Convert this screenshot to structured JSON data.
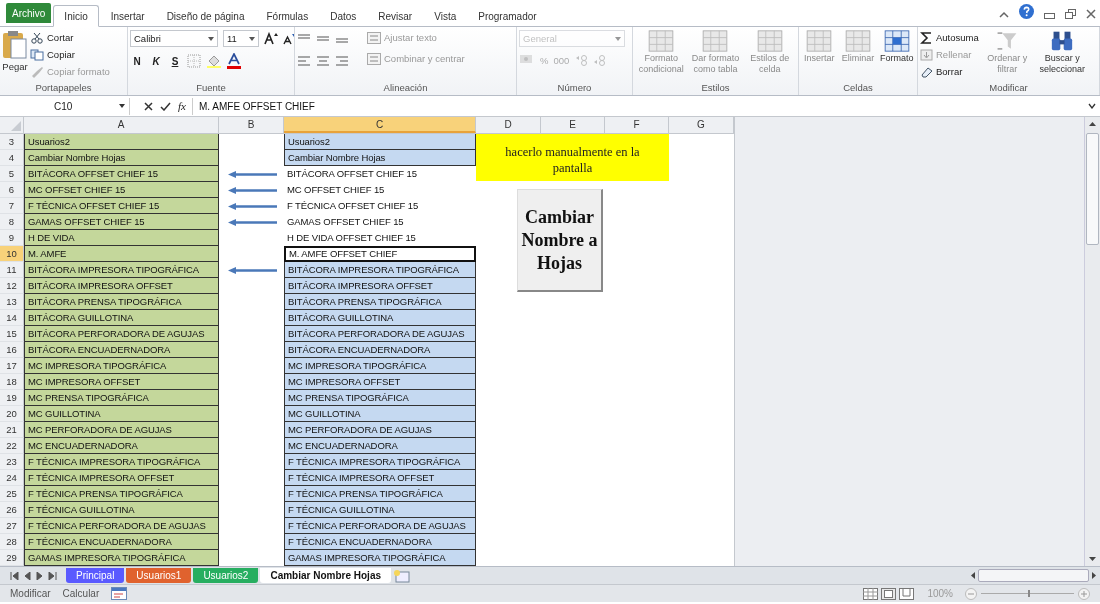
{
  "menu_tabs": [
    {
      "label": "Archivo",
      "kind": "file",
      "selected": false
    },
    {
      "label": "Inicio",
      "kind": "tab",
      "selected": true
    },
    {
      "label": "Insertar",
      "kind": "tab",
      "selected": false
    },
    {
      "label": "Diseño de página",
      "kind": "tab",
      "selected": false
    },
    {
      "label": "Fórmulas",
      "kind": "tab",
      "selected": false
    },
    {
      "label": "Datos",
      "kind": "tab",
      "selected": false
    },
    {
      "label": "Revisar",
      "kind": "tab",
      "selected": false
    },
    {
      "label": "Vista",
      "kind": "tab",
      "selected": false
    },
    {
      "label": "Programador",
      "kind": "tab",
      "selected": false
    }
  ],
  "ribbon": [
    {
      "kind": "clipboard",
      "label": "Portapapeles",
      "paste": "Pegar",
      "items": [
        {
          "label": "Cortar",
          "disabled": false
        },
        {
          "label": "Copiar",
          "disabled": false
        },
        {
          "label": "Copiar formato",
          "disabled": true
        }
      ]
    },
    {
      "kind": "font",
      "label": "Fuente",
      "font": "Calibri",
      "size": "11",
      "styles": [
        "N",
        "K",
        "S"
      ]
    },
    {
      "kind": "align",
      "label": "Alineación",
      "items": [
        {
          "label": "Ajustar texto",
          "disabled": true
        },
        {
          "label": "Combinar y centrar",
          "disabled": true
        }
      ]
    },
    {
      "kind": "number",
      "label": "Número",
      "format": "General",
      "symbols": [
        "%",
        "000"
      ],
      "disabled": true
    },
    {
      "kind": "large",
      "label": "Estilos",
      "items": [
        {
          "label": "Formato condicional",
          "disabled": true
        },
        {
          "label": "Dar formato como tabla",
          "disabled": true
        },
        {
          "label": "Estilos de celda",
          "disabled": true
        }
      ]
    },
    {
      "kind": "large",
      "label": "Celdas",
      "items": [
        {
          "label": "Insertar",
          "disabled": true
        },
        {
          "label": "Eliminar",
          "disabled": true
        },
        {
          "label": "Formato",
          "disabled": false
        }
      ]
    },
    {
      "kind": "modify",
      "label": "Modificar",
      "items": [
        {
          "label": "Autosuma",
          "disabled": false
        },
        {
          "label": "Rellenar",
          "disabled": true
        },
        {
          "label": "Borrar",
          "disabled": false
        }
      ],
      "large": [
        {
          "label": "Ordenar y filtrar",
          "disabled": true
        },
        {
          "label": "Buscar y seleccionar",
          "disabled": false
        }
      ]
    }
  ],
  "formula_bar": {
    "name_box": "C10",
    "function_label": "fx",
    "value": "M. AMFE OFFSET CHIEF"
  },
  "columns": [
    {
      "label": "A",
      "selected": false
    },
    {
      "label": "B",
      "selected": false
    },
    {
      "label": "C",
      "selected": true
    },
    {
      "label": "D",
      "selected": false
    },
    {
      "label": "E",
      "selected": false
    },
    {
      "label": "F",
      "selected": false
    },
    {
      "label": "G",
      "selected": false
    }
  ],
  "rows": [
    {
      "num": "3",
      "a": "Usuarios2",
      "c": "Usuarios2",
      "highlighted": true,
      "arrow": false,
      "selected": false
    },
    {
      "num": "4",
      "a": "Cambiar Nombre Hojas",
      "c": "Cambiar Nombre Hojas",
      "highlighted": true,
      "arrow": false,
      "selected": false
    },
    {
      "num": "5",
      "a": "BITÁCORA OFFSET CHIEF 15",
      "c": "BITÁCORA OFFSET CHIEF 15",
      "highlighted": false,
      "arrow": true,
      "selected": false
    },
    {
      "num": "6",
      "a": "MC OFFSET CHIEF 15",
      "c": "MC OFFSET CHIEF 15",
      "highlighted": false,
      "arrow": true,
      "selected": false
    },
    {
      "num": "7",
      "a": "F TÉCNICA OFFSET CHIEF 15",
      "c": "F TÉCNICA OFFSET CHIEF 15",
      "highlighted": false,
      "arrow": true,
      "selected": false
    },
    {
      "num": "8",
      "a": "GAMAS OFFSET CHIEF 15",
      "c": "GAMAS OFFSET CHIEF 15",
      "highlighted": false,
      "arrow": true,
      "selected": false
    },
    {
      "num": "9",
      "a": "H DE VIDA",
      "c": "H DE VIDA OFFSET CHIEF 15",
      "highlighted": false,
      "arrow": false,
      "selected": false
    },
    {
      "num": "10",
      "a": "M. AMFE",
      "c": "M. AMFE OFFSET CHIEF",
      "highlighted": false,
      "arrow": false,
      "selected": true
    },
    {
      "num": "11",
      "a": "BITÁCORA IMPRESORA TIPOGRÁFICA",
      "c": "BITÁCORA IMPRESORA TIPOGRÁFICA",
      "highlighted": true,
      "arrow": true,
      "selected": false
    },
    {
      "num": "12",
      "a": "BITÁCORA IMPRESORA OFFSET",
      "c": "BITÁCORA IMPRESORA OFFSET",
      "highlighted": true,
      "arrow": false,
      "selected": false
    },
    {
      "num": "13",
      "a": "BITÁCORA PRENSA TIPOGRÁFICA",
      "c": "BITÁCORA PRENSA TIPOGRÁFICA",
      "highlighted": true,
      "arrow": false,
      "selected": false
    },
    {
      "num": "14",
      "a": "BITÁCORA GUILLOTINA",
      "c": "BITÁCORA GUILLOTINA",
      "highlighted": true,
      "arrow": false,
      "selected": false
    },
    {
      "num": "15",
      "a": "BITÁCORA PERFORADORA DE AGUJAS",
      "c": "BITÁCORA PERFORADORA DE AGUJAS",
      "highlighted": true,
      "arrow": false,
      "selected": false
    },
    {
      "num": "16",
      "a": "BITÁCORA ENCUADERNADORA",
      "c": "BITÁCORA ENCUADERNADORA",
      "highlighted": true,
      "arrow": false,
      "selected": false
    },
    {
      "num": "17",
      "a": "MC IMPRESORA TIPOGRÁFICA",
      "c": "MC IMPRESORA TIPOGRÁFICA",
      "highlighted": true,
      "arrow": false,
      "selected": false
    },
    {
      "num": "18",
      "a": "MC IMPRESORA OFFSET",
      "c": "MC IMPRESORA OFFSET",
      "highlighted": true,
      "arrow": false,
      "selected": false
    },
    {
      "num": "19",
      "a": "MC PRENSA TIPOGRÁFICA",
      "c": "MC PRENSA TIPOGRÁFICA",
      "highlighted": true,
      "arrow": false,
      "selected": false
    },
    {
      "num": "20",
      "a": "MC GUILLOTINA",
      "c": "MC GUILLOTINA",
      "highlighted": true,
      "arrow": false,
      "selected": false
    },
    {
      "num": "21",
      "a": "MC PERFORADORA DE AGUJAS",
      "c": "MC PERFORADORA DE AGUJAS",
      "highlighted": true,
      "arrow": false,
      "selected": false
    },
    {
      "num": "22",
      "a": "MC ENCUADERNADORA",
      "c": "MC ENCUADERNADORA",
      "highlighted": true,
      "arrow": false,
      "selected": false
    },
    {
      "num": "23",
      "a": "F TÉCNICA IMPRESORA TIPOGRÁFICA",
      "c": "F TÉCNICA IMPRESORA TIPOGRÁFICA",
      "highlighted": true,
      "arrow": false,
      "selected": false
    },
    {
      "num": "24",
      "a": "F TÉCNICA IMPRESORA OFFSET",
      "c": "F TÉCNICA IMPRESORA OFFSET",
      "highlighted": true,
      "arrow": false,
      "selected": false
    },
    {
      "num": "25",
      "a": "F TÉCNICA PRENSA TIPOGRÁFICA",
      "c": "F TÉCNICA PRENSA TIPOGRÁFICA",
      "highlighted": true,
      "arrow": false,
      "selected": false
    },
    {
      "num": "26",
      "a": "F TÉCNICA GUILLOTINA",
      "c": "F TÉCNICA GUILLOTINA",
      "highlighted": true,
      "arrow": false,
      "selected": false
    },
    {
      "num": "27",
      "a": "F TÉCNICA PERFORADORA DE AGUJAS",
      "c": "F TÉCNICA PERFORADORA DE AGUJAS",
      "highlighted": true,
      "arrow": false,
      "selected": false
    },
    {
      "num": "28",
      "a": "F TÉCNICA ENCUADERNADORA",
      "c": "F TÉCNICA ENCUADERNADORA",
      "highlighted": true,
      "arrow": false,
      "selected": false
    },
    {
      "num": "29",
      "a": "GAMAS IMPRESORA TIPOGRÁFICA",
      "c": "GAMAS IMPRESORA TIPOGRÁFICA",
      "highlighted": true,
      "arrow": false,
      "selected": false
    }
  ],
  "note": {
    "lines": [
      "hacerlo manualmente en la",
      "pantalla"
    ]
  },
  "macro_button": {
    "label": "Cambiar Nombre a Hojas"
  },
  "sheet_tabs": [
    {
      "label": "Principal",
      "color": "#5a5aff",
      "selected": false
    },
    {
      "label": "Usuarios1",
      "color": "#e0622e",
      "selected": false
    },
    {
      "label": "Usuarios2",
      "color": "#27ae60",
      "selected": false
    },
    {
      "label": "Cambiar Nombre Hojas",
      "color": "#ffffff",
      "selected": true
    }
  ],
  "status_bar": {
    "mode": "Modificar",
    "calc": "Calcular",
    "zoom": "100%",
    "zoom_slider": {
      "level": 0.5
    }
  }
}
